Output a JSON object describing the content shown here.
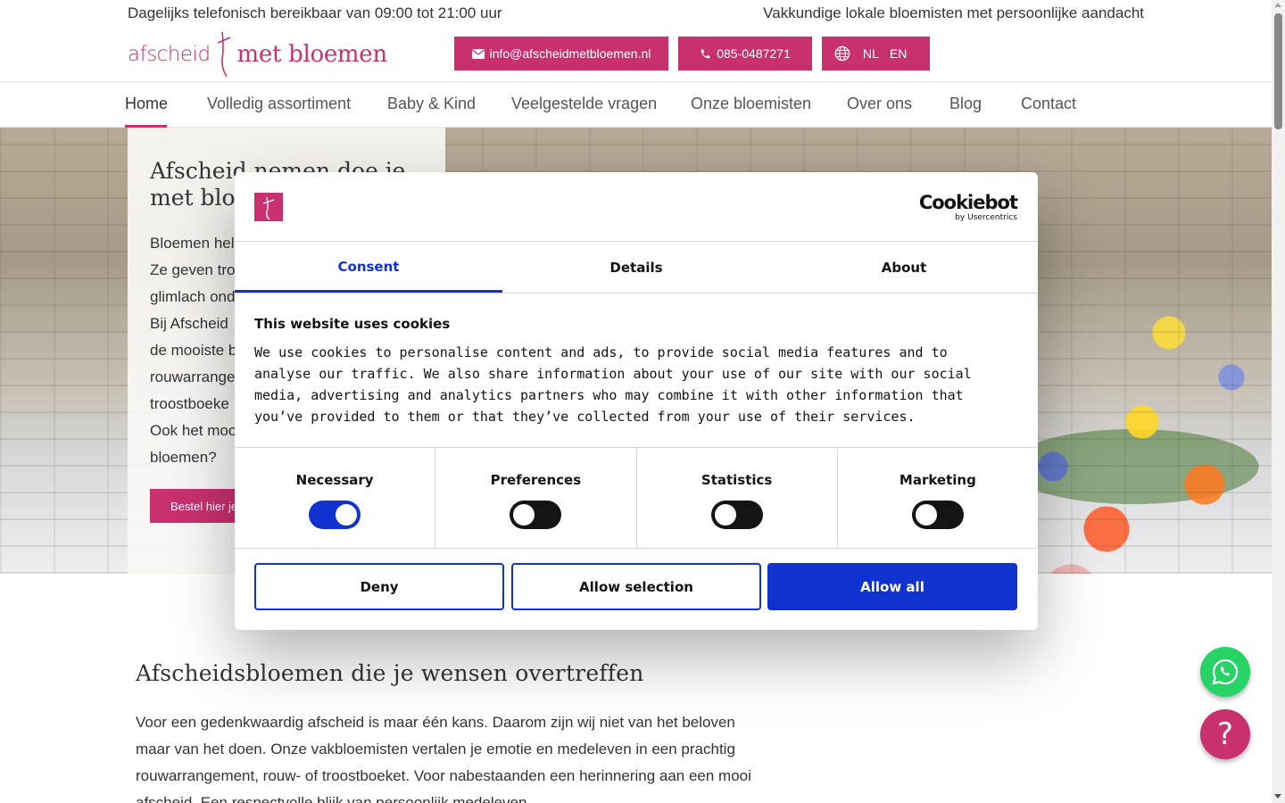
{
  "topbar": {
    "left_text": "Dagelijks telefonisch bereikbaar van 09:00 tot 21:00 uur",
    "right_text": "Vakkundige lokale bloemisten met persoonlijke aandacht"
  },
  "logo": {
    "part1": "afscheid",
    "part2": "met bloemen"
  },
  "header": {
    "email": "info@afscheidmetbloemen.nl",
    "phone": "085-0487271",
    "lang_nl": "NL",
    "lang_en": "EN"
  },
  "nav": {
    "items": [
      "Home",
      "Volledig assortiment",
      "Baby & Kind",
      "Veelgestelde vragen",
      "Onze bloemisten",
      "Over ons",
      "Blog",
      "Contact"
    ]
  },
  "hero": {
    "title_line1": "Afscheid nemen doe je",
    "title_line2": "met bloe",
    "lines": [
      "Bloemen hel",
      "Ze geven tro",
      "glimlach ond",
      "Bij Afscheid",
      "de mooiste b",
      "rouwarrange",
      "troostboeke",
      "Ook het moo",
      "bloemen?"
    ],
    "cta": "Bestel hier je"
  },
  "content": {
    "heading": "Afscheidsbloemen die je wensen overtreffen",
    "body_lines": [
      "Voor een gedenkwaardig afscheid is maar één kans. Daarom zijn wij niet van het beloven",
      "maar van het doen. Onze vakbloemisten vertalen je emotie en medeleven in een prachtig",
      "rouwarrangement, rouw- of troostboeket. Voor nabestaanden een herinnering aan een mooi",
      "afscheid. Een respectvolle blijk van persoonlijk medeleven."
    ]
  },
  "cookie": {
    "brand_title": "Cookiebot",
    "brand_sub": "by Usercentrics",
    "tabs": [
      "Consent",
      "Details",
      "About"
    ],
    "title": "This website uses cookies",
    "description": "We use cookies to personalise content and ads, to provide social media features and to analyse our traffic. We also share information about your use of our site with our social media, advertising and analytics partners who may combine it with other information that you’ve provided to them or that they’ve collected from your use of their services.",
    "categories": [
      {
        "label": "Necessary",
        "enabled": true
      },
      {
        "label": "Preferences",
        "enabled": false
      },
      {
        "label": "Statistics",
        "enabled": false
      },
      {
        "label": "Marketing",
        "enabled": false
      }
    ],
    "buttons": {
      "deny": "Deny",
      "selection": "Allow selection",
      "all": "Allow all"
    }
  },
  "help": {
    "glyph": "?"
  },
  "colors": {
    "brand": "#c8306e",
    "cookie_accent": "#1032cf",
    "whatsapp": "#25d366"
  }
}
